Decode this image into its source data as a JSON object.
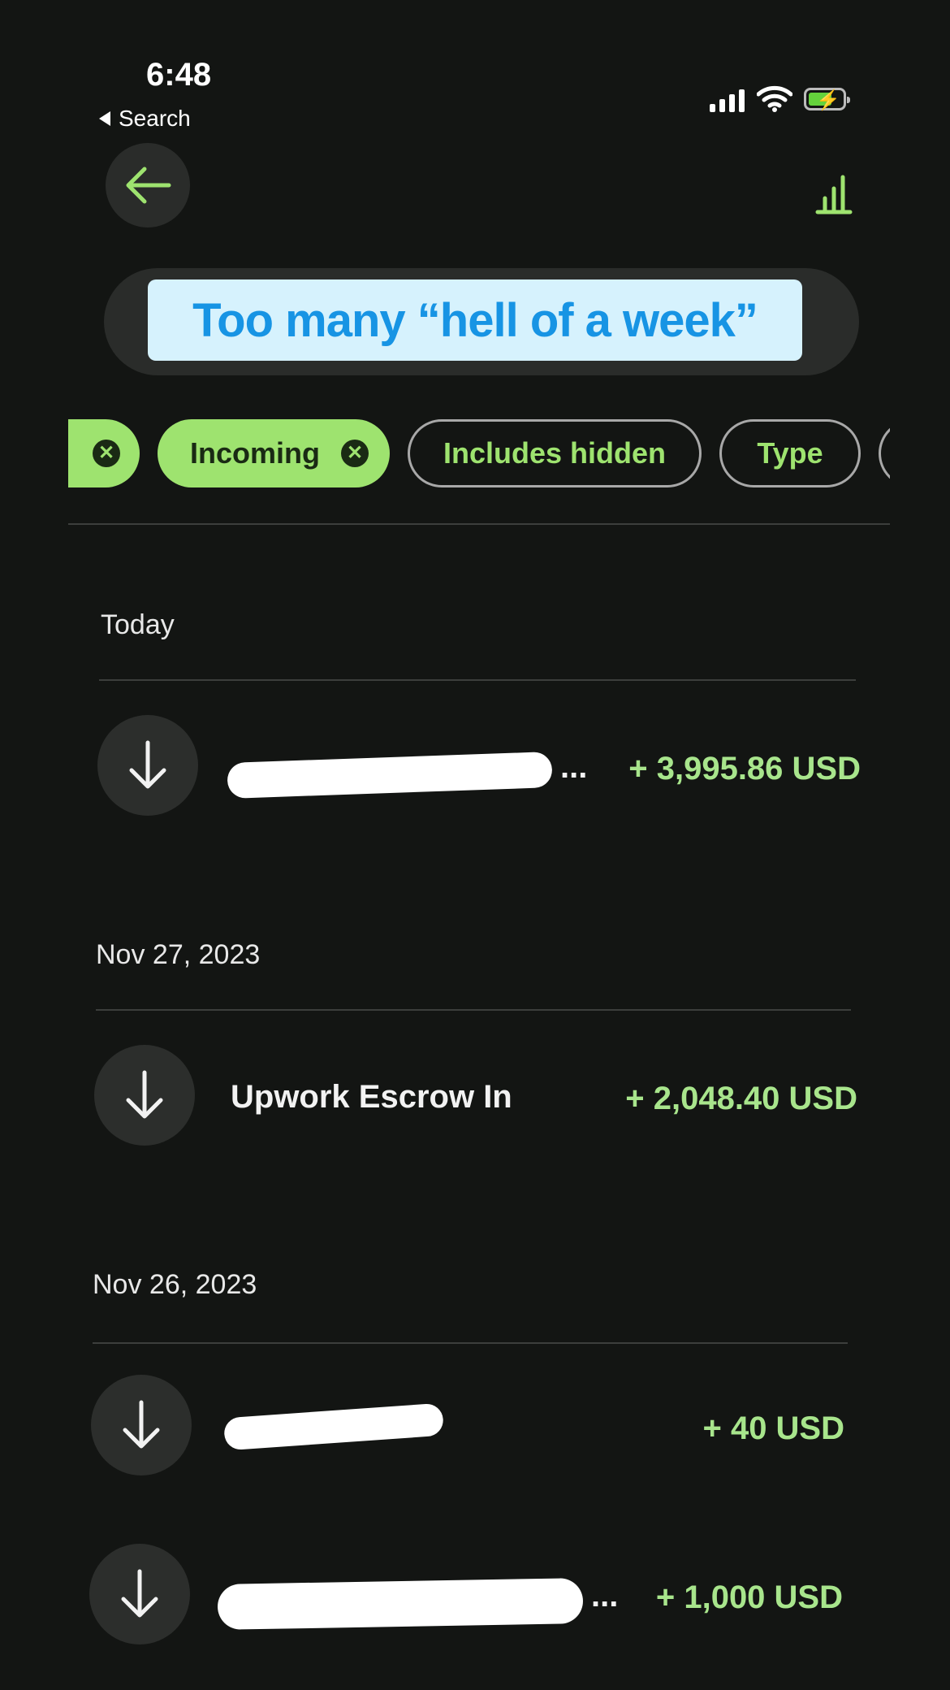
{
  "status_bar": {
    "time": "6:48",
    "back_app": "Search"
  },
  "header": {
    "back_icon": "arrow-left-icon",
    "chart_icon": "bar-chart-icon"
  },
  "caption": "Too many “hell of a week”",
  "filters": [
    {
      "label": "",
      "active": true
    },
    {
      "label": "Incoming",
      "active": true
    },
    {
      "label": "Includes hidden",
      "active": false
    },
    {
      "label": "Type",
      "active": false
    }
  ],
  "groups": [
    {
      "date": "Today",
      "transactions": [
        {
          "name": "",
          "name_suffix": "...",
          "amount": "+ 3,995.86 USD",
          "redacted": true
        }
      ]
    },
    {
      "date": "Nov 27, 2023",
      "transactions": [
        {
          "name": "Upwork Escrow In",
          "amount": "+ 2,048.40 USD",
          "redacted": false
        }
      ]
    },
    {
      "date": "Nov 26, 2023",
      "transactions": [
        {
          "name": "",
          "amount": "+ 40 USD",
          "redacted": true
        },
        {
          "name": "",
          "name_suffix": "...",
          "amount": "+ 1,000 USD",
          "redacted": true
        }
      ]
    }
  ],
  "colors": {
    "background": "#131513",
    "accent": "#9ee36f",
    "amount": "#a8e58c",
    "caption_bg": "#d6f2fd",
    "caption_text": "#1794e4"
  }
}
